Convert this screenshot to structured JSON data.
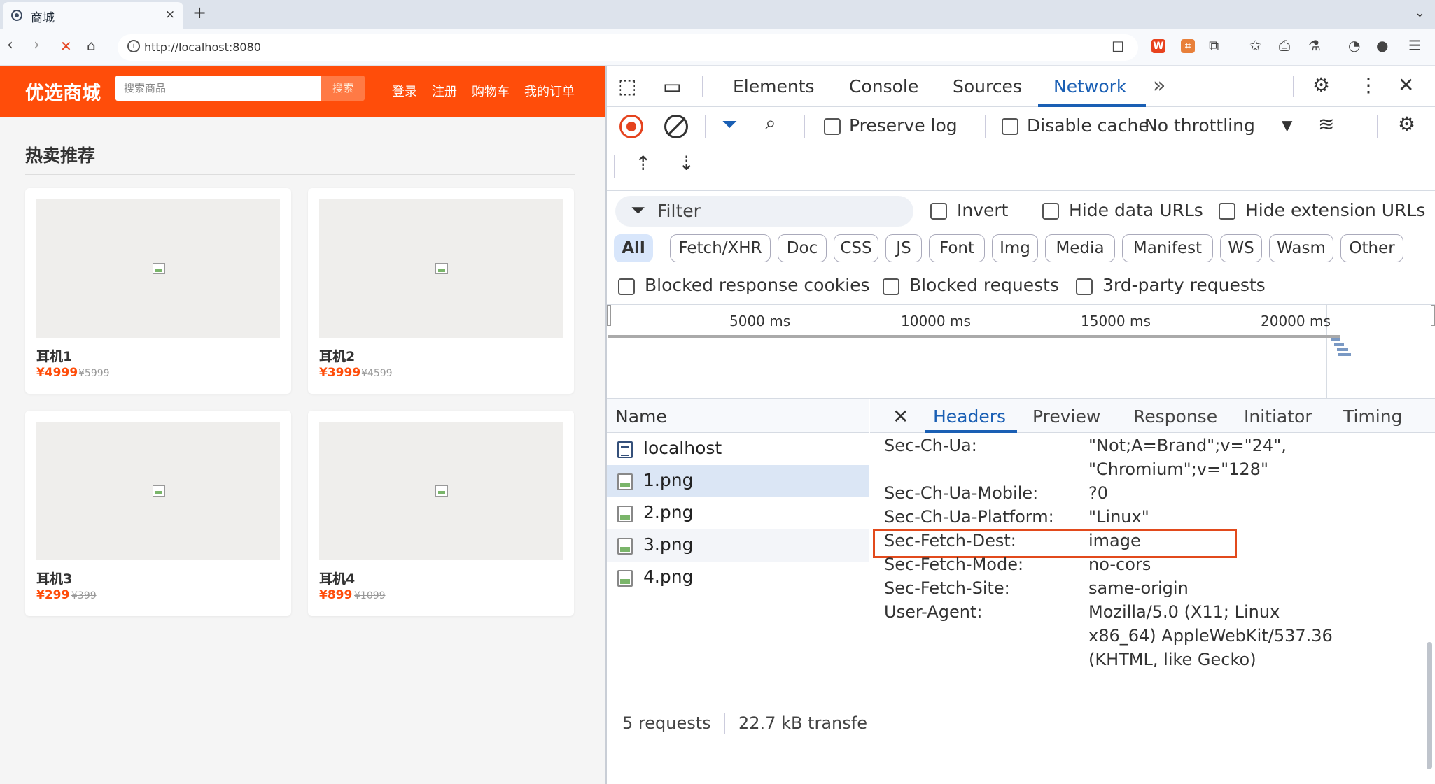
{
  "browser": {
    "tab_title": "商城",
    "tab_close": "×",
    "new_tab": "+",
    "url": "http://localhost:8080",
    "icons": [
      "back-icon",
      "forward-icon",
      "stop-icon",
      "home-icon",
      "info-icon",
      "bookmark-icon",
      "extensions-icon",
      "menu-icon"
    ]
  },
  "site": {
    "logo": "优选商城",
    "search_placeholder": "搜索商品",
    "search_button": "搜索",
    "nav": [
      "登录",
      "注册",
      "购物车",
      "我的订单"
    ],
    "section_title": "热卖推荐",
    "products": [
      {
        "name": "耳机1",
        "price": "¥4999",
        "old_price": "¥5999"
      },
      {
        "name": "耳机2",
        "price": "¥3999",
        "old_price": "¥4599"
      },
      {
        "name": "耳机3",
        "price": "¥299",
        "old_price": "¥399"
      },
      {
        "name": "耳机4",
        "price": "¥899",
        "old_price": "¥1099"
      }
    ],
    "accent_color": "#ff4d0a"
  },
  "devtools": {
    "tabs": [
      "Elements",
      "Console",
      "Sources",
      "Network"
    ],
    "more_tabs": "»",
    "active_tab": "Network",
    "toolbar": {
      "preserve_log": "Preserve log",
      "disable_cache": "Disable cache",
      "throttling": "No throttling"
    },
    "filter": {
      "placeholder": "Filter",
      "invert": "Invert",
      "hide_data_urls": "Hide data URLs",
      "hide_extension_urls": "Hide extension URLs",
      "types": [
        "All",
        "Fetch/XHR",
        "Doc",
        "CSS",
        "JS",
        "Font",
        "Img",
        "Media",
        "Manifest",
        "WS",
        "Wasm",
        "Other"
      ],
      "blocked_cookies": "Blocked response cookies",
      "blocked_requests": "Blocked requests",
      "third_party": "3rd-party requests"
    },
    "timeline_ticks": [
      "5000 ms",
      "10000 ms",
      "15000 ms",
      "20000 ms"
    ],
    "requests_header": "Name",
    "requests": [
      "localhost",
      "1.png",
      "2.png",
      "3.png",
      "4.png"
    ],
    "status": {
      "count": "5 requests",
      "transferred": "22.7 kB transfe"
    },
    "detail_tabs": [
      "Headers",
      "Preview",
      "Response",
      "Initiator",
      "Timing"
    ],
    "headers": [
      {
        "key": "Sec-Ch-Ua:",
        "value": "\"Not;A=Brand\";v=\"24\",",
        "value2": "\"Chromium\";v=\"128\""
      },
      {
        "key": "Sec-Ch-Ua-Mobile:",
        "value": "?0"
      },
      {
        "key": "Sec-Ch-Ua-Platform:",
        "value": "\"Linux\""
      },
      {
        "key": "Sec-Fetch-Dest:",
        "value": "image"
      },
      {
        "key": "Sec-Fetch-Mode:",
        "value": "no-cors"
      },
      {
        "key": "Sec-Fetch-Site:",
        "value": "same-origin"
      },
      {
        "key": "User-Agent:",
        "value": "Mozilla/5.0 (X11; Linux",
        "value2": "x86_64) AppleWebKit/537.36",
        "value3": "(KHTML, like Gecko)"
      }
    ],
    "highlight_color": "#e24a1c"
  }
}
